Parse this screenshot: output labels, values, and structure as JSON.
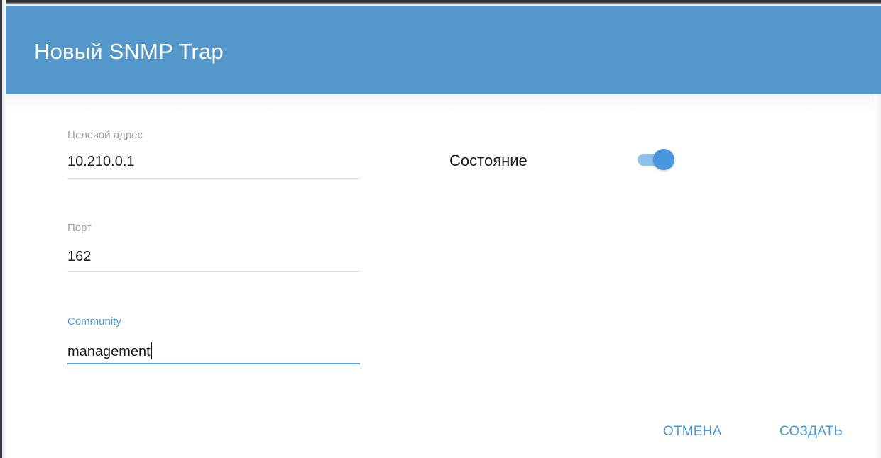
{
  "dialog": {
    "title": "Новый SNMP Trap"
  },
  "form": {
    "target_address": {
      "label": "Целевой адрес",
      "value": "10.210.0.1"
    },
    "port": {
      "label": "Порт",
      "value": "162"
    },
    "community": {
      "label": "Community",
      "value": "management"
    }
  },
  "state": {
    "label": "Состояние",
    "enabled": true
  },
  "buttons": {
    "cancel": "ОТМЕНА",
    "create": "СОЗДАТЬ"
  },
  "colors": {
    "header": "#5497cb",
    "accent": "#4a9ad9",
    "toggle_thumb": "#4a97e0",
    "toggle_track": "#8ec0ec"
  }
}
